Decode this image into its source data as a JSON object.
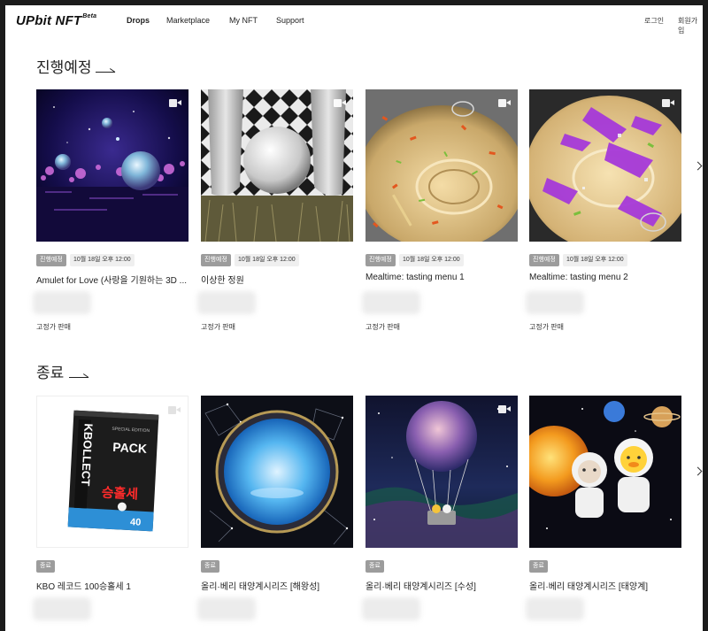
{
  "header": {
    "logo": "UPbit NFT",
    "logo_beta": "Beta",
    "nav": [
      {
        "label": "Drops",
        "active": true
      },
      {
        "label": "Marketplace",
        "active": false
      },
      {
        "label": "My NFT",
        "active": false
      },
      {
        "label": "Support",
        "active": false
      }
    ],
    "login": "로그인",
    "signup": "회원가입"
  },
  "ongoing": {
    "title": "진행예정",
    "cards": [
      {
        "badge": "진행예정",
        "time": "10월 18일 오후 12:00",
        "title": "Amulet for Love (사랑을 기원하는 3D ...",
        "sale": "고정가 판매",
        "has_video": true,
        "art": "amulet"
      },
      {
        "badge": "진행예정",
        "time": "10월 18일 오후 12:00",
        "title": "이상한 정원",
        "sale": "고정가 판매",
        "has_video": true,
        "art": "garden"
      },
      {
        "badge": "진행예정",
        "time": "10월 18일 오후 12:00",
        "title": "Mealtime: tasting menu 1",
        "sale": "고정가 판매",
        "has_video": true,
        "art": "meal1"
      },
      {
        "badge": "진행예정",
        "time": "10월 18일 오후 12:00",
        "title": "Mealtime: tasting menu 2",
        "sale": "고정가 판매",
        "has_video": true,
        "art": "meal2"
      }
    ]
  },
  "ended": {
    "title": "종료",
    "cards": [
      {
        "badge": "종료",
        "title": "KBO 레코드 100승홀세 1",
        "has_video": true,
        "art": "kbo"
      },
      {
        "badge": "종료",
        "title": "올리·베리 태양계시리즈 [해왕성]",
        "has_video": false,
        "art": "neptune"
      },
      {
        "badge": "종료",
        "title": "올리·베리 태양계시리즈 [수성]",
        "has_video": true,
        "art": "mercury"
      },
      {
        "badge": "종료",
        "title": "올리·베리 태양계시리즈 [태양계]",
        "has_video": false,
        "art": "solar"
      }
    ]
  },
  "kbo_art": {
    "small_caption": "SPECIAL EDITION",
    "brand": "KBOLLECT",
    "pack": "PACK",
    "wins": "승홀세",
    "count": "40"
  },
  "colors": {
    "badge_gray": "#9c9c9c",
    "time_bg": "#efefef",
    "text": "#222222"
  },
  "icons": [
    "video-icon",
    "chevron-right-icon",
    "arrow-right-icon"
  ]
}
